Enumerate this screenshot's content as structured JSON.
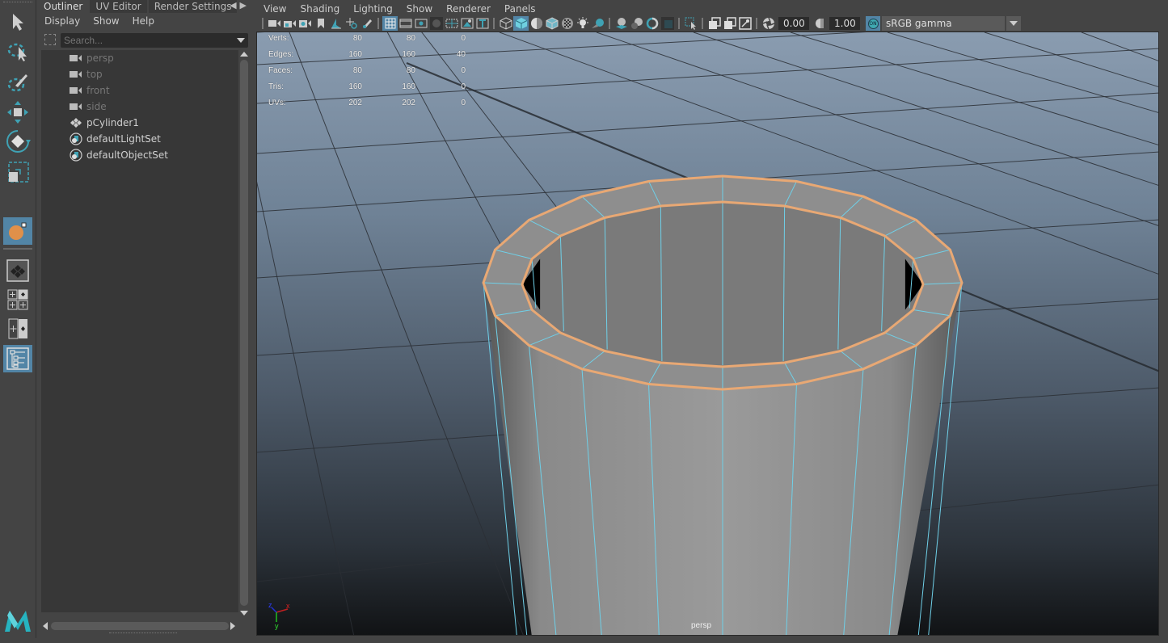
{
  "app": {
    "name": "Maya"
  },
  "toolbox": {
    "tools": [
      {
        "name": "select-tool",
        "icon": "arrow-icon"
      },
      {
        "name": "lasso-tool",
        "icon": "lasso-icon"
      },
      {
        "name": "paint-select-tool",
        "icon": "paint-select-icon"
      },
      {
        "name": "move-tool",
        "icon": "move-icon"
      },
      {
        "name": "rotate-tool",
        "icon": "rotate-icon"
      },
      {
        "name": "scale-tool",
        "icon": "scale-icon"
      },
      {
        "name": "last-tool",
        "icon": "soft-select-icon",
        "active": true
      }
    ],
    "layouts": [
      "single-perspective-layout",
      "four-view-layout",
      "persp-outliner-layout",
      "outliner-layout"
    ]
  },
  "outliner": {
    "tabs": [
      {
        "label": "Outliner",
        "active": true
      },
      {
        "label": "UV Editor",
        "active": false
      },
      {
        "label": "Render Settings",
        "active": false
      }
    ],
    "menu": [
      "Display",
      "Show",
      "Help"
    ],
    "search": {
      "placeholder": "Search...",
      "value": ""
    },
    "items": [
      {
        "label": "persp",
        "icon": "camera-icon",
        "dimmed": true
      },
      {
        "label": "top",
        "icon": "camera-icon",
        "dimmed": true
      },
      {
        "label": "front",
        "icon": "camera-icon",
        "dimmed": true
      },
      {
        "label": "side",
        "icon": "camera-icon",
        "dimmed": true
      },
      {
        "label": "pCylinder1",
        "icon": "mesh-icon",
        "dimmed": false
      },
      {
        "label": "defaultLightSet",
        "icon": "set-icon",
        "dimmed": false
      },
      {
        "label": "defaultObjectSet",
        "icon": "set-icon",
        "dimmed": false
      }
    ]
  },
  "viewport": {
    "menu": [
      "View",
      "Shading",
      "Lighting",
      "Show",
      "Renderer",
      "Panels"
    ],
    "exposure": "0.00",
    "gamma": "1.00",
    "color_management": "ON",
    "color_space": "sRGB gamma",
    "camera": "persp",
    "hud": {
      "rows": [
        {
          "label": "Verts:",
          "values": [
            "80",
            "80",
            "0"
          ]
        },
        {
          "label": "Edges:",
          "values": [
            "160",
            "160",
            "40"
          ]
        },
        {
          "label": "Faces:",
          "values": [
            "80",
            "80",
            "0"
          ]
        },
        {
          "label": "Tris:",
          "values": [
            "160",
            "160",
            "0"
          ]
        },
        {
          "label": "UVs:",
          "values": [
            "202",
            "202",
            "0"
          ]
        }
      ]
    },
    "axis": {
      "x": "x",
      "y": "y",
      "z": "z"
    },
    "colors": {
      "selection": "#e8a874",
      "wire": "#6fd0e8",
      "grid": "#2b2f35",
      "accent": "#5285a6"
    }
  }
}
